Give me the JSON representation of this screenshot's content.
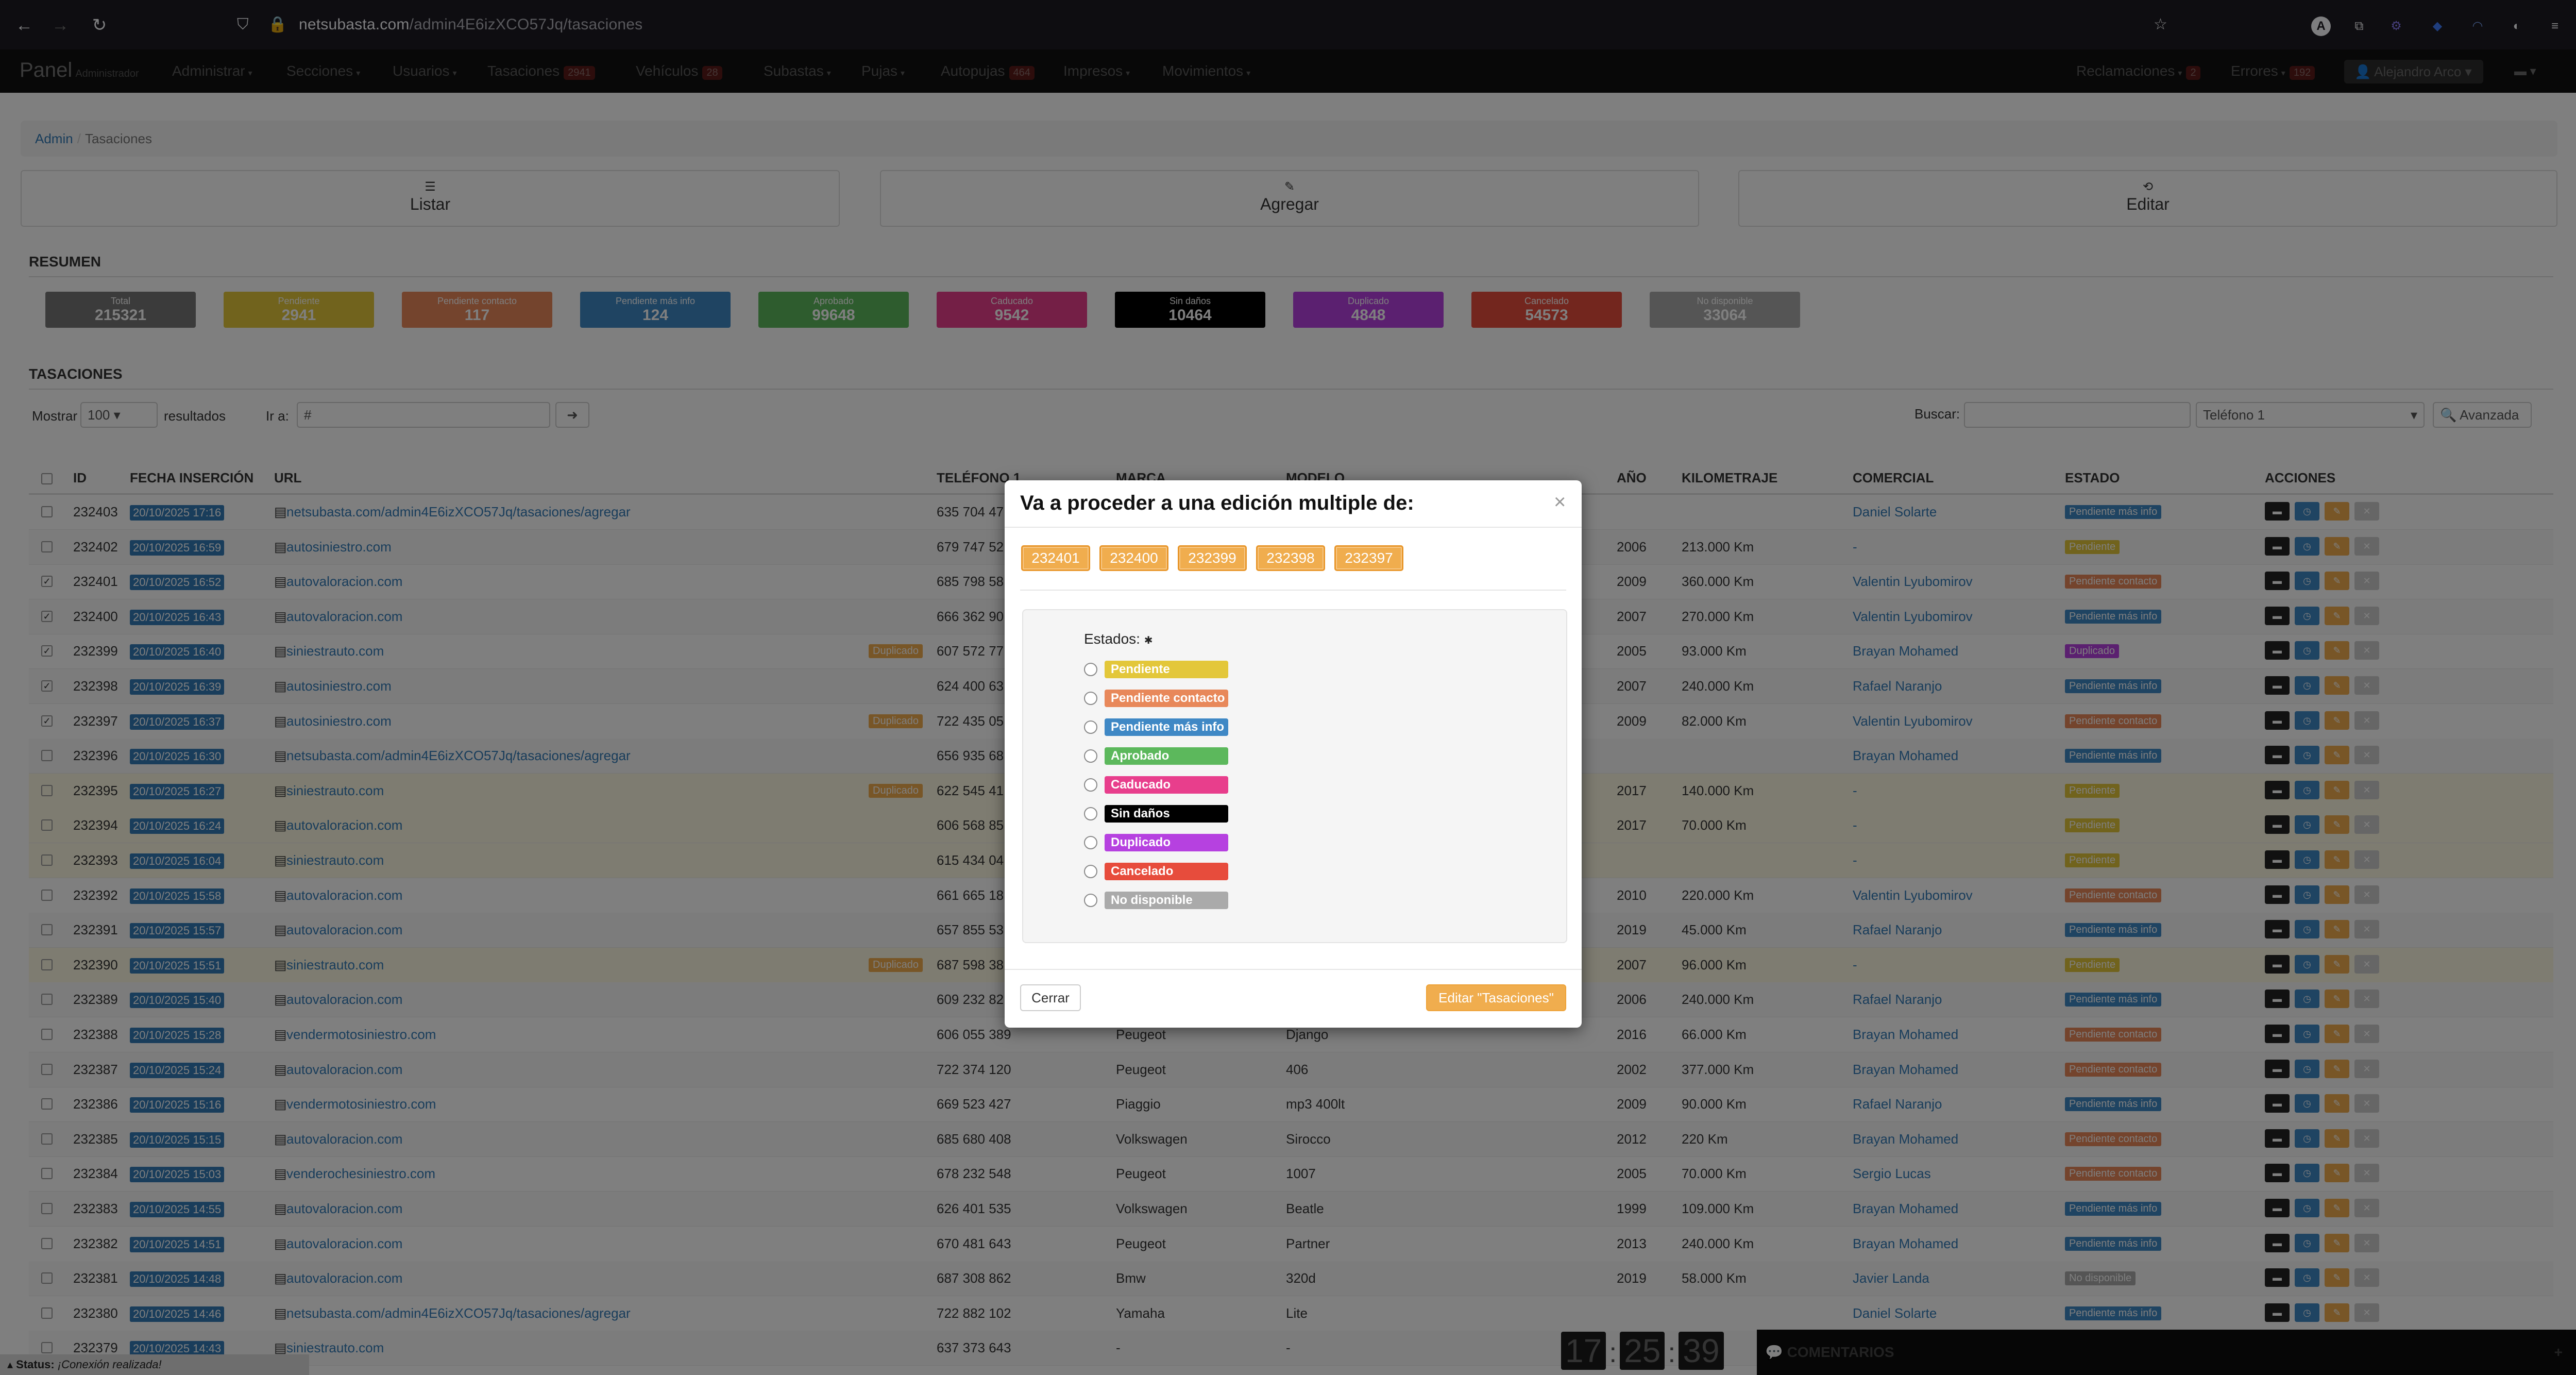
{
  "browser": {
    "url_host": "netsubasta.com",
    "url_path": "/admin4E6izXCO57Jq/tasaciones"
  },
  "navbar": {
    "brand": "Panel",
    "brand_sub": "Administrador",
    "items": [
      {
        "label": "Administrar",
        "badge": ""
      },
      {
        "label": "Secciones",
        "badge": ""
      },
      {
        "label": "Usuarios",
        "badge": ""
      },
      {
        "label": "Tasaciones",
        "badge": "2941"
      },
      {
        "label": "Vehículos",
        "badge": "28"
      },
      {
        "label": "Subastas",
        "badge": ""
      },
      {
        "label": "Pujas",
        "badge": ""
      },
      {
        "label": "Autopujas",
        "badge": "464"
      },
      {
        "label": "Impresos",
        "badge": ""
      },
      {
        "label": "Movimientos",
        "badge": ""
      }
    ],
    "right": [
      {
        "label": "Reclamaciones",
        "badge": "2"
      },
      {
        "label": "Errores",
        "badge": "192"
      }
    ],
    "user": "Alejandro Arco"
  },
  "breadcrumb": {
    "home": "Admin",
    "current": "Tasaciones"
  },
  "actions": {
    "list": "Listar",
    "add": "Agregar",
    "edit": "Editar"
  },
  "summary": {
    "title": "RESUMEN",
    "stats": [
      {
        "label": "Total",
        "value": "215321",
        "color": "#777777"
      },
      {
        "label": "Pendiente",
        "value": "2941",
        "color": "#e3c73a"
      },
      {
        "label": "Pendiente contacto",
        "value": "117",
        "color": "#e8885a"
      },
      {
        "label": "Pendiente más info",
        "value": "124",
        "color": "#3f88c5"
      },
      {
        "label": "Aprobado",
        "value": "99648",
        "color": "#5cb85c"
      },
      {
        "label": "Caducado",
        "value": "9542",
        "color": "#e83e8c"
      },
      {
        "label": "Sin daños",
        "value": "10464",
        "color": "#000000"
      },
      {
        "label": "Duplicado",
        "value": "4848",
        "color": "#b641e0"
      },
      {
        "label": "Cancelado",
        "value": "54573",
        "color": "#e74c3c"
      },
      {
        "label": "No disponible",
        "value": "33064",
        "color": "#aaaaaa"
      }
    ]
  },
  "tasaciones": {
    "title": "TASACIONES",
    "show_label": "Mostrar",
    "show_value": "100",
    "results_label": "resultados",
    "goto_label": "Ir a:",
    "goto_prefix": "#",
    "search_label": "Buscar:",
    "search_field": "Teléfono 1",
    "advanced": "Avanzada",
    "columns": [
      "ID",
      "FECHA INSERCIÓN",
      "URL",
      "TELÉFONO 1",
      "MARCA",
      "MODELO",
      "AÑO",
      "KILOMETRAJE",
      "COMERCIAL",
      "ESTADO",
      "ACCIONES"
    ],
    "rows": [
      {
        "id": "232403",
        "date": "20/10/2025 17:16",
        "url": "netsubasta.com/admin4E6izXCO57Jq/tasaciones/agregar",
        "dup": "",
        "tel": "635 704 47",
        "marca": "",
        "modelo": "",
        "anio": "",
        "km": "",
        "comercial": "Daniel Solarte",
        "estado": "Pendiente más info",
        "estado_color": "#3f88c5",
        "checked": false,
        "rowclass": ""
      },
      {
        "id": "232402",
        "date": "20/10/2025 16:59",
        "url": "autosiniestro.com",
        "dup": "",
        "tel": "679 747 52",
        "marca": "",
        "modelo": "",
        "anio": "2006",
        "km": "213.000 Km",
        "comercial": "-",
        "estado": "Pendiente",
        "estado_color": "#e3c73a",
        "checked": false,
        "rowclass": "alt"
      },
      {
        "id": "232401",
        "date": "20/10/2025 16:52",
        "url": "autovaloracion.com",
        "dup": "",
        "tel": "685 798 58",
        "marca": "",
        "modelo": "",
        "anio": "2009",
        "km": "360.000 Km",
        "comercial": "Valentin Lyubomirov",
        "estado": "Pendiente contacto",
        "estado_color": "#e8885a",
        "checked": true,
        "rowclass": ""
      },
      {
        "id": "232400",
        "date": "20/10/2025 16:43",
        "url": "autovaloracion.com",
        "dup": "",
        "tel": "666 362 90",
        "marca": "",
        "modelo": "",
        "anio": "2007",
        "km": "270.000 Km",
        "comercial": "Valentin Lyubomirov",
        "estado": "Pendiente más info",
        "estado_color": "#3f88c5",
        "checked": true,
        "rowclass": "alt"
      },
      {
        "id": "232399",
        "date": "20/10/2025 16:40",
        "url": "siniestrauto.com",
        "dup": "Duplicado",
        "tel": "607 572 77",
        "marca": "",
        "modelo": "",
        "anio": "2005",
        "km": "93.000 Km",
        "comercial": "Brayan Mohamed",
        "estado": "Duplicado",
        "estado_color": "#b641e0",
        "checked": true,
        "rowclass": ""
      },
      {
        "id": "232398",
        "date": "20/10/2025 16:39",
        "url": "autosiniestro.com",
        "dup": "",
        "tel": "624 400 63",
        "marca": "",
        "modelo": "",
        "anio": "2007",
        "km": "240.000 Km",
        "comercial": "Rafael Naranjo",
        "estado": "Pendiente más info",
        "estado_color": "#3f88c5",
        "checked": true,
        "rowclass": "alt"
      },
      {
        "id": "232397",
        "date": "20/10/2025 16:37",
        "url": "autosiniestro.com",
        "dup": "Duplicado",
        "tel": "722 435 05",
        "marca": "",
        "modelo": "",
        "anio": "2009",
        "km": "82.000 Km",
        "comercial": "Valentin Lyubomirov",
        "estado": "Pendiente contacto",
        "estado_color": "#e8885a",
        "checked": true,
        "rowclass": ""
      },
      {
        "id": "232396",
        "date": "20/10/2025 16:30",
        "url": "netsubasta.com/admin4E6izXCO57Jq/tasaciones/agregar",
        "dup": "",
        "tel": "656 935 68",
        "marca": "",
        "modelo": "",
        "anio": "",
        "km": "",
        "comercial": "Brayan Mohamed",
        "estado": "Pendiente más info",
        "estado_color": "#3f88c5",
        "checked": false,
        "rowclass": "alt"
      },
      {
        "id": "232395",
        "date": "20/10/2025 16:27",
        "url": "siniestrauto.com",
        "dup": "Duplicado",
        "tel": "622 545 41",
        "marca": "",
        "modelo": "",
        "anio": "2017",
        "km": "140.000 Km",
        "comercial": "-",
        "estado": "Pendiente",
        "estado_color": "#e3c73a",
        "checked": false,
        "rowclass": "warn"
      },
      {
        "id": "232394",
        "date": "20/10/2025 16:24",
        "url": "autovaloracion.com",
        "dup": "",
        "tel": "606 568 85",
        "marca": "",
        "modelo": "",
        "anio": "2017",
        "km": "70.000 Km",
        "comercial": "-",
        "estado": "Pendiente",
        "estado_color": "#e3c73a",
        "checked": false,
        "rowclass": "warn"
      },
      {
        "id": "232393",
        "date": "20/10/2025 16:04",
        "url": "siniestrauto.com",
        "dup": "",
        "tel": "615 434 04",
        "marca": "",
        "modelo": "",
        "anio": "",
        "km": "",
        "comercial": "-",
        "estado": "Pendiente",
        "estado_color": "#e3c73a",
        "checked": false,
        "rowclass": "warn"
      },
      {
        "id": "232392",
        "date": "20/10/2025 15:58",
        "url": "autovaloracion.com",
        "dup": "",
        "tel": "661 665 18",
        "marca": "",
        "modelo": "",
        "anio": "2010",
        "km": "220.000 Km",
        "comercial": "Valentin Lyubomirov",
        "estado": "Pendiente contacto",
        "estado_color": "#e8885a",
        "checked": false,
        "rowclass": ""
      },
      {
        "id": "232391",
        "date": "20/10/2025 15:57",
        "url": "autovaloracion.com",
        "dup": "",
        "tel": "657 855 53",
        "marca": "",
        "modelo": "",
        "anio": "2019",
        "km": "45.000 Km",
        "comercial": "Rafael Naranjo",
        "estado": "Pendiente más info",
        "estado_color": "#3f88c5",
        "checked": false,
        "rowclass": "alt"
      },
      {
        "id": "232390",
        "date": "20/10/2025 15:51",
        "url": "siniestrauto.com",
        "dup": "Duplicado",
        "tel": "687 598 38",
        "marca": "",
        "modelo": "",
        "anio": "2007",
        "km": "96.000 Km",
        "comercial": "-",
        "estado": "Pendiente",
        "estado_color": "#e3c73a",
        "checked": false,
        "rowclass": "warn"
      },
      {
        "id": "232389",
        "date": "20/10/2025 15:40",
        "url": "autovaloracion.com",
        "dup": "",
        "tel": "609 232 82",
        "marca": "",
        "modelo": "",
        "anio": "2006",
        "km": "240.000 Km",
        "comercial": "Rafael Naranjo",
        "estado": "Pendiente más info",
        "estado_color": "#3f88c5",
        "checked": false,
        "rowclass": "alt"
      },
      {
        "id": "232388",
        "date": "20/10/2025 15:28",
        "url": "vendermotosiniestro.com",
        "dup": "",
        "tel": "606 055 389",
        "marca": "Peugeot",
        "modelo": "Django",
        "anio": "2016",
        "km": "66.000 Km",
        "comercial": "Brayan Mohamed",
        "estado": "Pendiente contacto",
        "estado_color": "#e8885a",
        "checked": false,
        "rowclass": ""
      },
      {
        "id": "232387",
        "date": "20/10/2025 15:24",
        "url": "autovaloracion.com",
        "dup": "",
        "tel": "722 374 120",
        "marca": "Peugeot",
        "modelo": "406",
        "anio": "2002",
        "km": "377.000 Km",
        "comercial": "Brayan Mohamed",
        "estado": "Pendiente contacto",
        "estado_color": "#e8885a",
        "checked": false,
        "rowclass": "alt"
      },
      {
        "id": "232386",
        "date": "20/10/2025 15:16",
        "url": "vendermotosiniestro.com",
        "dup": "",
        "tel": "669 523 427",
        "marca": "Piaggio",
        "modelo": "mp3 400lt",
        "anio": "2009",
        "km": "90.000 Km",
        "comercial": "Rafael Naranjo",
        "estado": "Pendiente más info",
        "estado_color": "#3f88c5",
        "checked": false,
        "rowclass": ""
      },
      {
        "id": "232385",
        "date": "20/10/2025 15:15",
        "url": "autovaloracion.com",
        "dup": "",
        "tel": "685 680 408",
        "marca": "Volkswagen",
        "modelo": "Sirocco",
        "anio": "2012",
        "km": "220 Km",
        "comercial": "Brayan Mohamed",
        "estado": "Pendiente contacto",
        "estado_color": "#e8885a",
        "checked": false,
        "rowclass": "alt"
      },
      {
        "id": "232384",
        "date": "20/10/2025 15:03",
        "url": "venderochesiniestro.com",
        "dup": "",
        "tel": "678 232 548",
        "marca": "Peugeot",
        "modelo": "1007",
        "anio": "2005",
        "km": "70.000 Km",
        "comercial": "Sergio Lucas",
        "estado": "Pendiente contacto",
        "estado_color": "#e8885a",
        "checked": false,
        "rowclass": ""
      },
      {
        "id": "232383",
        "date": "20/10/2025 14:55",
        "url": "autovaloracion.com",
        "dup": "",
        "tel": "626 401 535",
        "marca": "Volkswagen",
        "modelo": "Beatle",
        "anio": "1999",
        "km": "109.000 Km",
        "comercial": "Brayan Mohamed",
        "estado": "Pendiente más info",
        "estado_color": "#3f88c5",
        "checked": false,
        "rowclass": "alt"
      },
      {
        "id": "232382",
        "date": "20/10/2025 14:51",
        "url": "autovaloracion.com",
        "dup": "",
        "tel": "670 481 643",
        "marca": "Peugeot",
        "modelo": "Partner",
        "anio": "2013",
        "km": "240.000 Km",
        "comercial": "Brayan Mohamed",
        "estado": "Pendiente más info",
        "estado_color": "#3f88c5",
        "checked": false,
        "rowclass": ""
      },
      {
        "id": "232381",
        "date": "20/10/2025 14:48",
        "url": "autovaloracion.com",
        "dup": "",
        "tel": "687 308 862",
        "marca": "Bmw",
        "modelo": "320d",
        "anio": "2019",
        "km": "58.000 Km",
        "comercial": "Javier Landa",
        "estado": "No disponible",
        "estado_color": "#aaaaaa",
        "checked": false,
        "rowclass": "alt"
      },
      {
        "id": "232380",
        "date": "20/10/2025 14:46",
        "url": "netsubasta.com/admin4E6izXCO57Jq/tasaciones/agregar",
        "dup": "",
        "tel": "722 882 102",
        "marca": "Yamaha",
        "modelo": "Lite",
        "anio": "",
        "km": "",
        "comercial": "Daniel Solarte",
        "estado": "Pendiente más info",
        "estado_color": "#3f88c5",
        "checked": false,
        "rowclass": ""
      },
      {
        "id": "232379",
        "date": "20/10/2025 14:43",
        "url": "siniestrauto.com",
        "dup": "",
        "tel": "637 373 643",
        "marca": "-",
        "modelo": "-",
        "anio": "",
        "km": "",
        "comercial": "",
        "estado": "",
        "estado_color": "#3f88c5",
        "checked": false,
        "rowclass": "alt"
      }
    ]
  },
  "modal": {
    "title": "Va a proceder a una edición multiple de:",
    "close_glyph": "×",
    "ids": [
      "232401",
      "232400",
      "232399",
      "232398",
      "232397"
    ],
    "estados_label": "Estados:",
    "required_mark": "✱",
    "options": [
      {
        "label": "Pendiente",
        "color": "#e3c73a"
      },
      {
        "label": "Pendiente contacto",
        "color": "#e8885a"
      },
      {
        "label": "Pendiente más info",
        "color": "#3f88c5"
      },
      {
        "label": "Aprobado",
        "color": "#5cb85c"
      },
      {
        "label": "Caducado",
        "color": "#e83e8c"
      },
      {
        "label": "Sin daños",
        "color": "#000000"
      },
      {
        "label": "Duplicado",
        "color": "#b641e0"
      },
      {
        "label": "Cancelado",
        "color": "#e74c3c"
      },
      {
        "label": "No disponible",
        "color": "#aaaaaa"
      }
    ],
    "close_label": "Cerrar",
    "submit_label": "Editar \"Tasaciones\""
  },
  "clock": {
    "h": "17",
    "m": "25",
    "s": "39"
  },
  "comments_label": "COMENTARIOS",
  "status": {
    "label": "Status:",
    "text": "¡Conexión realizada!"
  }
}
